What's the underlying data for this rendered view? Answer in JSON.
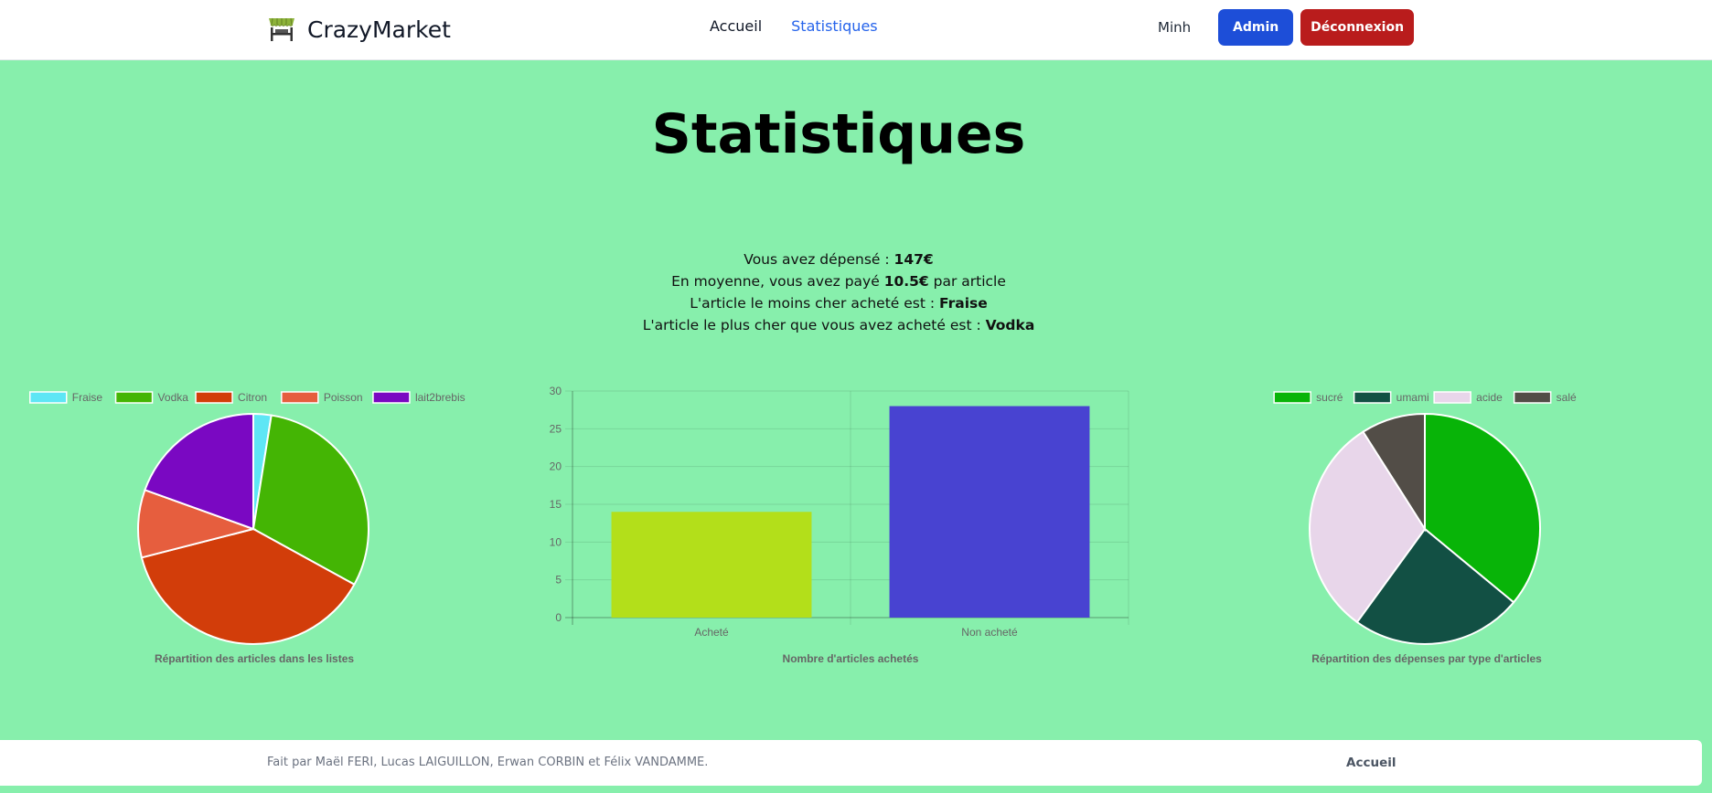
{
  "brand": {
    "name": "CrazyMarket",
    "logo": "market-stall-icon"
  },
  "nav": {
    "home": "Accueil",
    "stats": "Statistiques"
  },
  "user": {
    "name": "Minh",
    "admin_label": "Admin",
    "logout_label": "Déconnexion"
  },
  "page": {
    "title": "Statistiques"
  },
  "summary": {
    "spent_prefix": "Vous avez dépensé : ",
    "spent_value": "147€",
    "avg_prefix": "En moyenne, vous avez payé ",
    "avg_value": "10.5€",
    "avg_suffix": " par article",
    "cheapest_prefix": "L'article le moins cher acheté est : ",
    "cheapest_value": "Fraise",
    "priciest_prefix": "L'article le plus cher que vous avez acheté est : ",
    "priciest_value": "Vodka"
  },
  "footer": {
    "credits": "Fait par Maël FERI, Lucas LAIGUILLON, Erwan CORBIN et Félix VANDAMME.",
    "link": "Accueil"
  },
  "colors": {
    "background": "#87efac",
    "admin": "#1d4ed8",
    "logout": "#b91c1c",
    "nav_active": "#2563eb"
  },
  "chart_data": [
    {
      "type": "pie",
      "title": "Répartition des articles dans les listes",
      "labels": [
        "Fraise",
        "Vodka",
        "Citron",
        "Poisson",
        "lait2brebis"
      ],
      "values": [
        2.5,
        30.5,
        38,
        9.5,
        19.5
      ],
      "colors": [
        "#5ee6f5",
        "#44b504",
        "#d23d0a",
        "#e65e3e",
        "#7a08c2"
      ],
      "legend": "top"
    },
    {
      "type": "bar",
      "title": "Nombre d'articles achetés",
      "categories": [
        "Acheté",
        "Non acheté"
      ],
      "values": [
        14,
        28
      ],
      "colors": [
        "#b3df1a",
        "#4843d1"
      ],
      "ylim": [
        0,
        30
      ],
      "yticks": [
        0,
        5,
        10,
        15,
        20,
        25,
        30
      ],
      "grid": true
    },
    {
      "type": "pie",
      "title": "Répartition des dépenses par type d'articles",
      "labels": [
        "sucré",
        "umami",
        "acide",
        "salé"
      ],
      "values": [
        36,
        24,
        31,
        9
      ],
      "colors": [
        "#08b408",
        "#125044",
        "#e8d6ea",
        "#524d47"
      ],
      "legend": "top"
    }
  ]
}
